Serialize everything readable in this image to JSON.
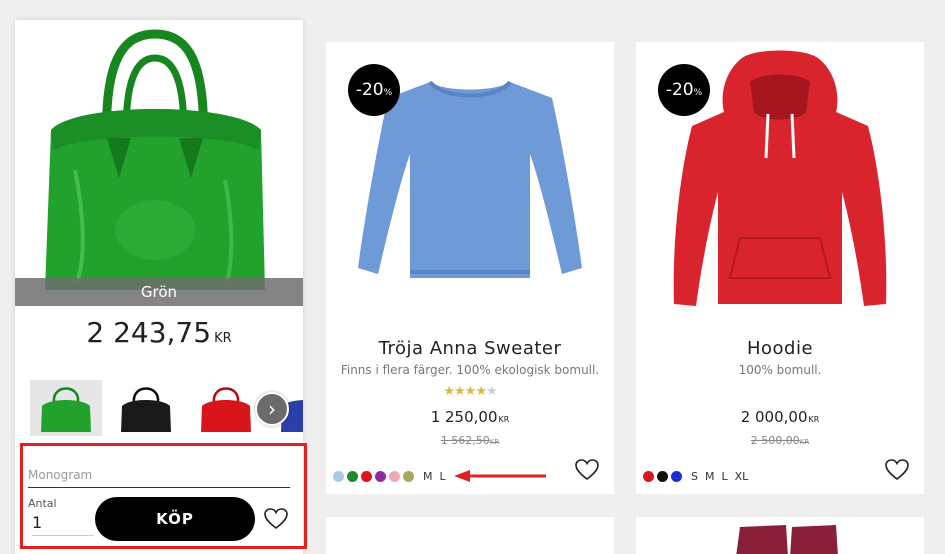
{
  "expanded_product": {
    "color_label": "Grön",
    "price": "2 243,75",
    "currency": "KR",
    "thumbnails": [
      {
        "name": "green-bag",
        "color": "#1f9a2a",
        "selected": true
      },
      {
        "name": "black-bag",
        "color": "#1a1a1a",
        "selected": false
      },
      {
        "name": "red-bag",
        "color": "#d9151c",
        "selected": false
      },
      {
        "name": "blue-bag",
        "color": "#2a3fa8",
        "selected": false
      }
    ],
    "monogram_placeholder": "Monogram",
    "quantity_label": "Antal",
    "quantity_value": "1",
    "buy_label": "KÖP"
  },
  "products": [
    {
      "badge": "-20",
      "badge_unit": "%",
      "title": "Tröja Anna Sweater",
      "subtitle": "Finns i flera färger. 100% ekologisk bomull.",
      "rating": 4,
      "rating_max": 5,
      "price": "1 250,00",
      "old_price": "1 562,50",
      "currency": "KR",
      "swatches": [
        "#a9c8ea",
        "#1f8a2c",
        "#e0141c",
        "#8e2aa6",
        "#f0a6b6",
        "#a9a85c"
      ],
      "sizes": [
        "M",
        "L"
      ]
    },
    {
      "badge": "-20",
      "badge_unit": "%",
      "title": "Hoodie",
      "subtitle": "100% bomull.",
      "price": "2 000,00",
      "old_price": "2 500,00",
      "currency": "KR",
      "swatches": [
        "#e0141c",
        "#111111",
        "#1a2fd6"
      ],
      "sizes": [
        "S",
        "M",
        "L",
        "XL"
      ]
    }
  ],
  "colors": {
    "highlight": "#e32020",
    "star": "#e0b73c",
    "badge": "#000000"
  }
}
